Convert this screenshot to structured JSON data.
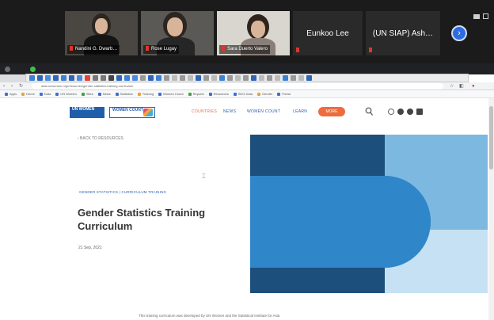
{
  "zoom": {
    "participants": [
      {
        "name": "Nandini G. Dwarb…"
      },
      {
        "name": "Rose Lugay"
      },
      {
        "name": "Sara Duerto Valero"
      },
      {
        "name": "Eunkoo Lee"
      },
      {
        "name": "(UN SIAP) Ash…"
      }
    ],
    "next_label": "›"
  },
  "browser": {
    "url": "data.unwomen.org/resources/gender-statistics-training-curriculum",
    "nav_back": "‹",
    "nav_forward": "›",
    "nav_reload": "↻",
    "bookmarks": [
      "Apps",
      "Home",
      "Data",
      "UN Women",
      "Sites",
      "News",
      "Statistics",
      "Training",
      "Women Count",
      "Reports",
      "Resources",
      "SDG Data",
      "Gender",
      "Portal"
    ]
  },
  "site": {
    "logo_unwomen": "UN WOMEN",
    "logo_womencount": "WOMEN COUNT",
    "menu": [
      "COUNTRIES",
      "NEWS",
      "WOMEN COUNT",
      "LEARN"
    ],
    "menu_pill": "MORE",
    "back_link": "‹ BACK TO RESOURCES",
    "breadcrumb": "GENDER STATISTICS | CURRICULUM TRAINING",
    "title": "Gender Statistics Training Curriculum",
    "date": "21 Sep, 2021",
    "intro": "This training curriculum was developed by UN Women and the Statistical Institute for Asia"
  },
  "colors": {
    "hero_dark": "#1c4f7c",
    "hero_mid": "#2f86c9",
    "hero_light": "#7cb8e0",
    "hero_pale": "#c5e1f3",
    "accent_orange": "#ef6b3d",
    "link_blue": "#2a5fb0"
  }
}
